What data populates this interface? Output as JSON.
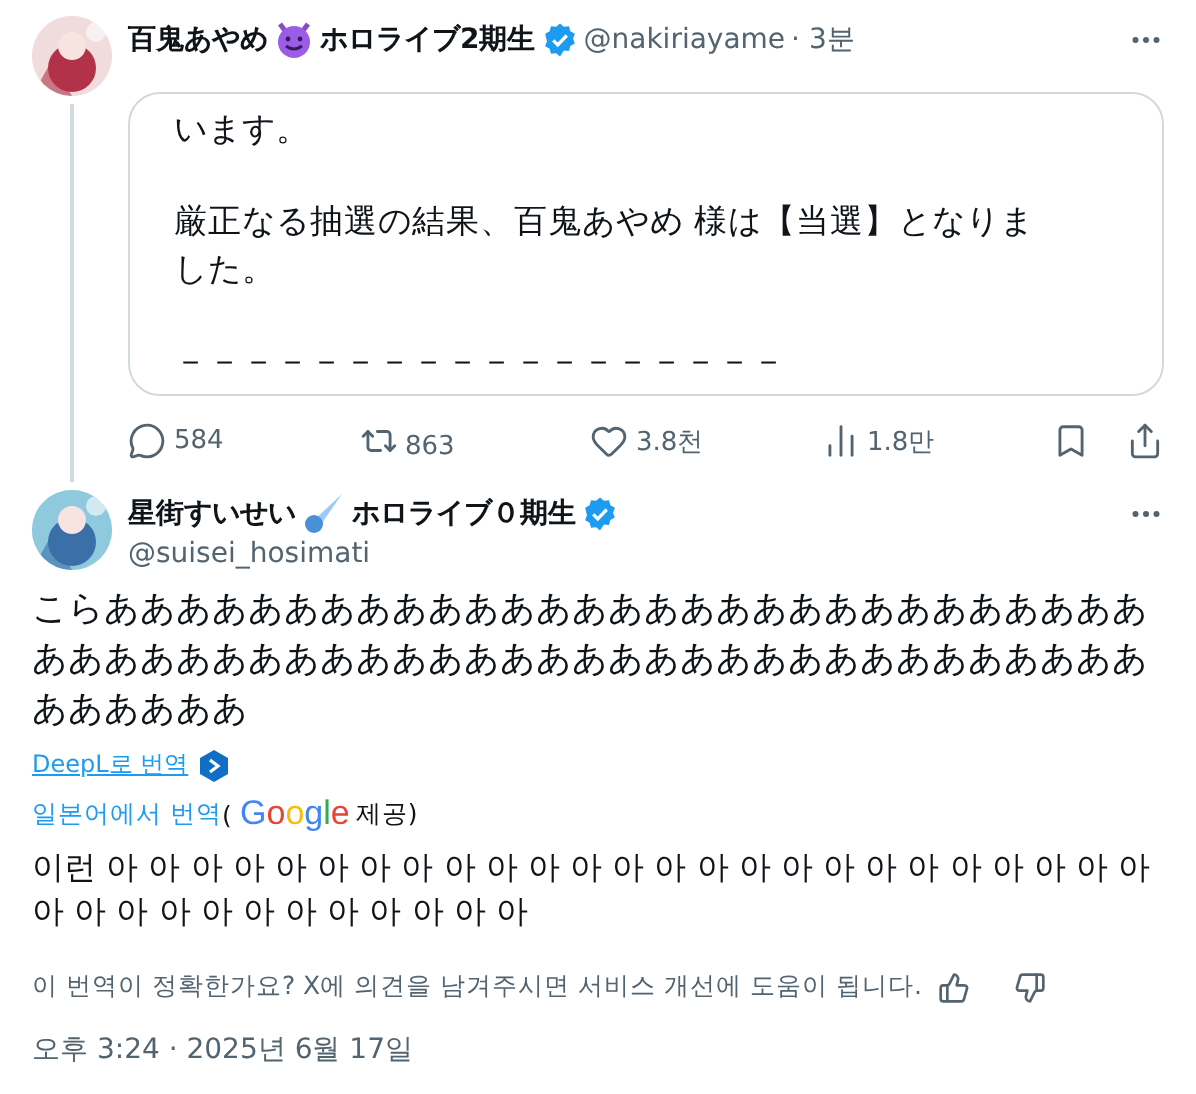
{
  "quoted_post": {
    "author": "百鬼あやめ",
    "author_suffix": "ホロライブ2期生",
    "verified": true,
    "handle": "@nakiriayame",
    "time": "· 3분",
    "card_paragraphs": [
      "います。",
      "厳正なる抽選の結果、百鬼あやめ 様は【当選】となりました。",
      "－－－－－－－－－－－－－－－－－－"
    ],
    "actions": [
      {
        "kind": "reply",
        "count": "584"
      },
      {
        "kind": "repost",
        "count": "863"
      },
      {
        "kind": "like",
        "count": "3.8천"
      },
      {
        "kind": "views",
        "count": "1.8만"
      },
      {
        "kind": "bookmark"
      },
      {
        "kind": "share"
      }
    ]
  },
  "post": {
    "author": "星街すいせい",
    "author_suffix": "ホロライブ０期生",
    "verified": true,
    "handle": "@suisei_hosimati",
    "text": "こらああああああああああああああああああああああああああああああああああああああああああああああああああああああああああああああああああ",
    "deepl_link": "DeepL로 번역",
    "translated_from": "일본어에서 번역",
    "provider_open": "(",
    "provider_logo": "Google",
    "provider_close": "제공)",
    "translation": "이런 아 아 아 아 아 아 아 아 아 아 아 아 아 아 아 아 아 아 아 아 아 아 아 아 아 아 아 아 아 아 아 아 아 아 아 아 아",
    "feedback": "이 번역이 정확한가요? X에 의견을 남겨주시면 서비스 개선에 도움이 됩니다.",
    "timestamp": "오후 3:24 · 2025년 6월 17일"
  }
}
